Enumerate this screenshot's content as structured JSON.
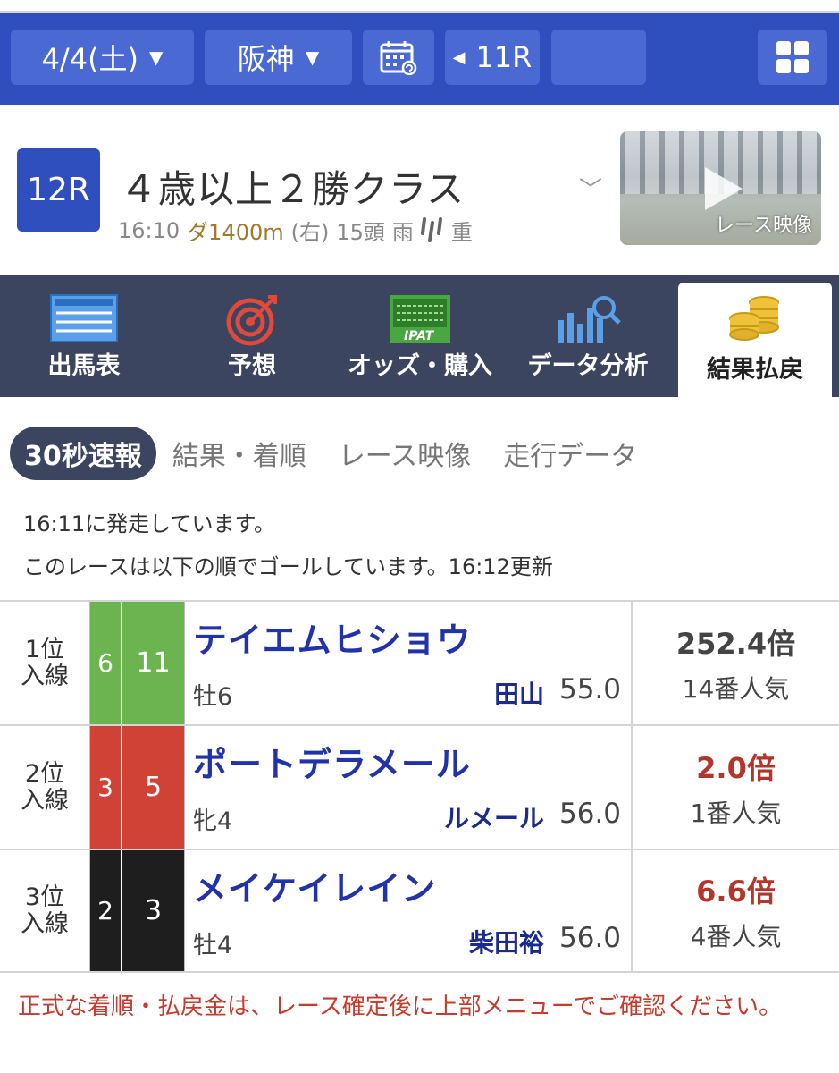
{
  "topbar": {
    "date": "4/4(土)",
    "venue": "阪神",
    "prev_race": "11R",
    "next_race": ""
  },
  "race": {
    "number": "12R",
    "title": "４歳以上２勝クラス",
    "time": "16:10",
    "distance": "ダ1400m",
    "direction": "(右)",
    "runners": "15頭",
    "weather": "雨",
    "track_condition": "重",
    "video_label": "レース映像"
  },
  "nav": {
    "items": [
      {
        "label": "出馬表",
        "icon": "entry-list-icon"
      },
      {
        "label": "予想",
        "icon": "target-icon"
      },
      {
        "label": "オッズ・購入",
        "icon": "ipat-icon"
      },
      {
        "label": "データ分析",
        "icon": "analysis-icon"
      },
      {
        "label": "結果払戻",
        "icon": "coins-icon"
      }
    ],
    "active_index": 4
  },
  "subtabs": [
    "30秒速報",
    "結果・着順",
    "レース映像",
    "走行データ"
  ],
  "info": {
    "start_text": "16:11に発走しています。",
    "goal_text": "このレースは以下の順でゴールしています。16:12更新"
  },
  "results": [
    {
      "rank_line1": "1位",
      "rank_line2": "入線",
      "waku": "6",
      "waku_color": "#6bb44f",
      "umaban": "11",
      "horse": "テイエムヒショウ",
      "sexage": "牡6",
      "jockey": "田山",
      "weight": "55.0",
      "odds": "252.4倍",
      "odds_hot": false,
      "popularity": "14番人気"
    },
    {
      "rank_line1": "2位",
      "rank_line2": "入線",
      "waku": "3",
      "waku_color": "#cf4235",
      "umaban": "5",
      "horse": "ポートデラメール",
      "sexage": "牝4",
      "jockey": "ルメール",
      "weight": "56.0",
      "odds": "2.0倍",
      "odds_hot": true,
      "popularity": "1番人気"
    },
    {
      "rank_line1": "3位",
      "rank_line2": "入線",
      "waku": "2",
      "waku_color": "#1e1e1e",
      "umaban": "3",
      "horse": "メイケイレイン",
      "sexage": "牡4",
      "jockey": "柴田裕",
      "weight": "56.0",
      "odds": "6.6倍",
      "odds_hot": true,
      "popularity": "4番人気"
    }
  ],
  "note": "正式な着順・払戻金は、レース確定後に上部メニューでご確認ください。",
  "colors": {
    "brand_blue": "#2f4fbf",
    "nav_dark": "#3b4560",
    "horse_name": "#2233aa",
    "hot_odds": "#b3362b",
    "notice": "#c93a2c"
  }
}
